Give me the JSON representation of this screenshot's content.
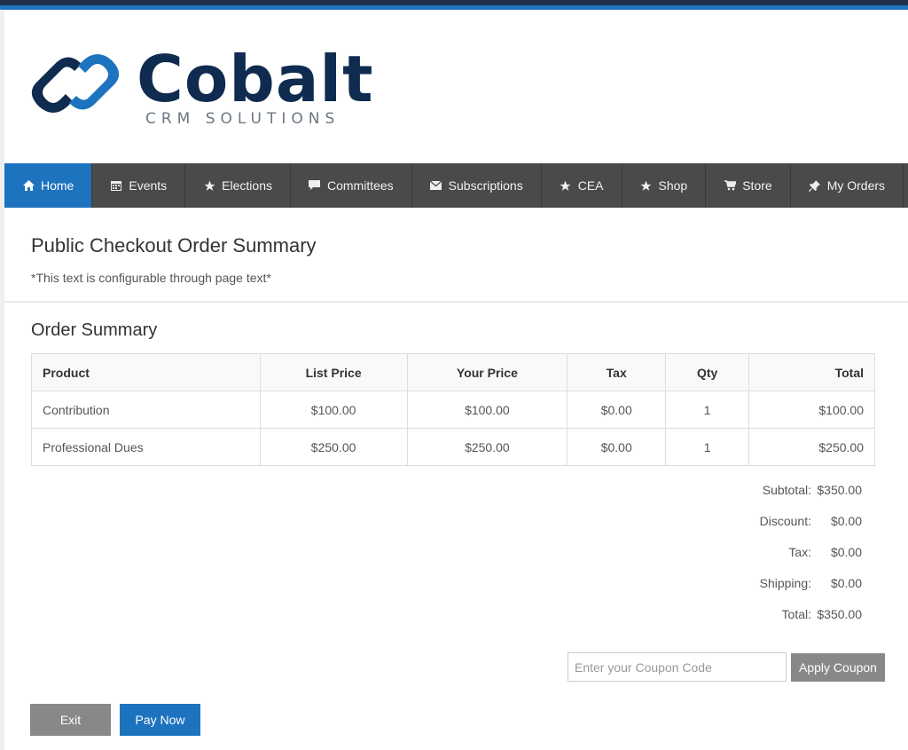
{
  "brand": {
    "name": "Cobalt",
    "tagline": "CRM SOLUTIONS",
    "colors": {
      "navy": "#0f2b4f",
      "blue": "#1e73be",
      "gray": "#6b7785"
    }
  },
  "nav": {
    "items": [
      {
        "label": "Home",
        "icon": "home-icon"
      },
      {
        "label": "Events",
        "icon": "calendar-icon"
      },
      {
        "label": "Elections",
        "icon": "star-icon"
      },
      {
        "label": "Committees",
        "icon": "comment-icon"
      },
      {
        "label": "Subscriptions",
        "icon": "envelope-icon"
      },
      {
        "label": "CEA",
        "icon": "star-icon"
      },
      {
        "label": "Shop",
        "icon": "star-icon"
      },
      {
        "label": "Store",
        "icon": "cart-icon"
      },
      {
        "label": "My Orders",
        "icon": "pin-icon"
      }
    ],
    "active": "Home"
  },
  "page": {
    "title": "Public Checkout Order Summary",
    "note": "*This text is configurable through page text*"
  },
  "order": {
    "section_title": "Order Summary",
    "columns": [
      "Product",
      "List Price",
      "Your Price",
      "Tax",
      "Qty",
      "Total"
    ],
    "rows": [
      [
        "Contribution",
        "$100.00",
        "$100.00",
        "$0.00",
        "1",
        "$100.00"
      ],
      [
        "Professional Dues",
        "$250.00",
        "$250.00",
        "$0.00",
        "1",
        "$250.00"
      ]
    ]
  },
  "totals": {
    "subtotal_label": "Subtotal:",
    "subtotal": "$350.00",
    "discount_label": "Discount:",
    "discount": "$0.00",
    "tax_label": "Tax:",
    "tax": "$0.00",
    "shipping_label": "Shipping:",
    "shipping": "$0.00",
    "total_label": "Total:",
    "total": "$350.00"
  },
  "coupon": {
    "placeholder": "Enter your Coupon Code",
    "value": "",
    "button_label": "Apply Coupon"
  },
  "actions": {
    "exit_label": "Exit",
    "pay_label": "Pay Now"
  }
}
